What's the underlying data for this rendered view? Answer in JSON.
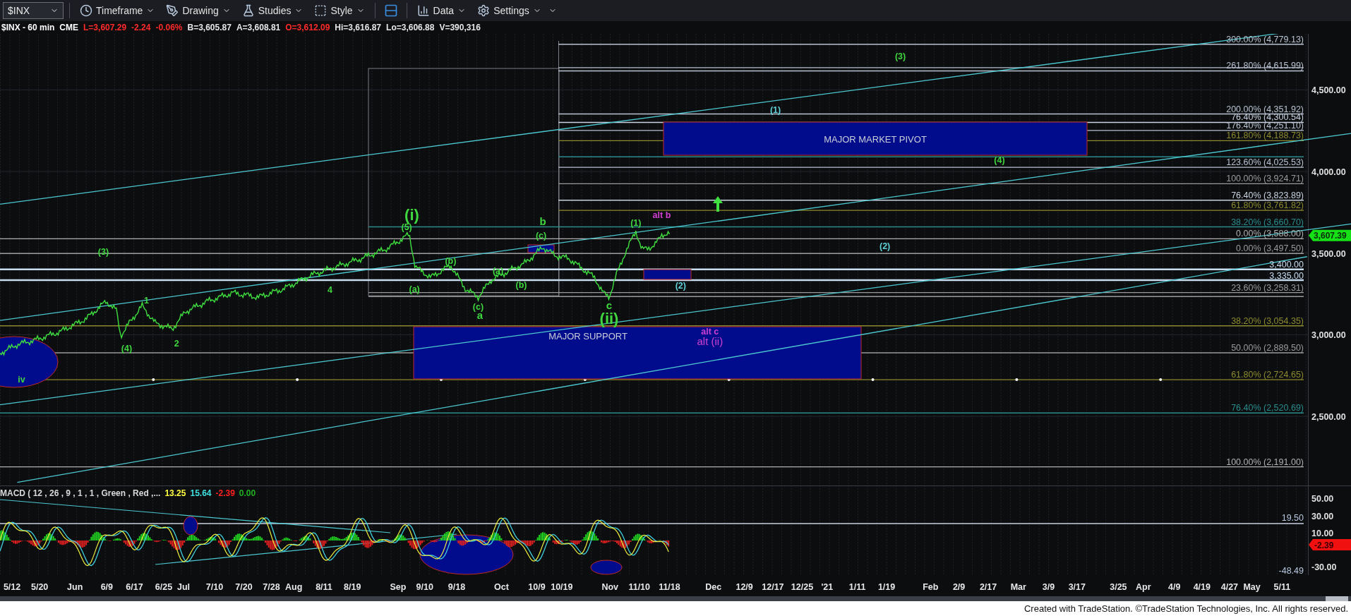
{
  "toolbar": {
    "symbol": "$INX",
    "menus": [
      {
        "label": "Timeframe"
      },
      {
        "label": "Drawing"
      },
      {
        "label": "Studies"
      },
      {
        "label": "Style"
      },
      {
        "label": "Data"
      },
      {
        "label": "Settings"
      }
    ]
  },
  "quote": [
    {
      "text": "$INX - 60 min",
      "color": "#ffffff"
    },
    {
      "text": "CME",
      "color": "#ffffff"
    },
    {
      "text": "L=3,607.29",
      "color": "#ff2a2a"
    },
    {
      "text": "-2.24",
      "color": "#ff2a2a"
    },
    {
      "text": "-0.06%",
      "color": "#ff2a2a"
    },
    {
      "text": "B=3,605.87",
      "color": "#e6e6e6"
    },
    {
      "text": "A=3,608.81",
      "color": "#e6e6e6"
    },
    {
      "text": "O=3,612.09",
      "color": "#ff2a2a"
    },
    {
      "text": "Hi=3,616.87",
      "color": "#e6e6e6"
    },
    {
      "text": "Lo=3,606.88",
      "color": "#e6e6e6"
    },
    {
      "text": "V=390,316",
      "color": "#e6e6e6"
    }
  ],
  "fib_levels": [
    {
      "label": "300.00% (4,779.13)",
      "color": "#b8c2d0"
    },
    {
      "label": "261.80% (4,615.99)",
      "color": "#b8c2d0"
    },
    {
      "label": "200.00% (4,351.92)",
      "color": "#b8c2d0"
    },
    {
      "label": "76.40% (4,300.54)",
      "color": "#c8d2e0"
    },
    {
      "label": "176.40% (4,251.10)",
      "color": "#b8c2d0"
    },
    {
      "label": "161.80% (4,188.73)",
      "color": "#8c8a2e"
    },
    {
      "label": "123.60% (4,025.53)",
      "color": "#b8c2d0"
    },
    {
      "label": "100.00% (3,924.71)",
      "color": "#9a9a9a"
    },
    {
      "label": "76.40% (3,823.89)",
      "color": "#c8d2e0"
    },
    {
      "label": "61.80% (3,761.82)",
      "color": "#8c8a2e"
    },
    {
      "label": "38.20% (3,660.70)",
      "color": "#2a8c8c"
    },
    {
      "label": "0.00% (3,588.00)",
      "color": "#b0b0b0"
    },
    {
      "label": "0.00% (3,497.50)",
      "color": "#9a9a9a"
    },
    {
      "label": "3,400.00",
      "color": "#c8dcf0"
    },
    {
      "label": "3,335.00",
      "color": "#c8dcf0"
    },
    {
      "label": "23.60% (3,258.31)",
      "color": "#9a9a9a"
    },
    {
      "label": "38.20% (3,054.35)",
      "color": "#8c8a2e"
    },
    {
      "label": "50.00% (2,889.50)",
      "color": "#9a9a9a"
    },
    {
      "label": "61.80% (2,724.65)",
      "color": "#8c8a2e"
    },
    {
      "label": "76.40% (2,520.69)",
      "color": "#2a8c8c"
    },
    {
      "label": "100.00% (2,191.00)",
      "color": "#b0b0b0"
    }
  ],
  "price_axis": {
    "ticks": [
      "4,500.00",
      "4,000.00",
      "3,500.00",
      "3,000.00",
      "2,500.00"
    ],
    "last_price": "3,607.39"
  },
  "zones": [
    {
      "label": "MAJOR MARKET PIVOT"
    },
    {
      "label": "MAJOR SUPPORT"
    }
  ],
  "wave_labels": [
    {
      "text": "(3)",
      "kind": "minor",
      "color": "#3fd63f"
    },
    {
      "text": "(1)",
      "kind": "minor",
      "color": "#5fd0d8"
    },
    {
      "text": "(4)",
      "kind": "minor",
      "color": "#3fd63f"
    },
    {
      "text": "(2)",
      "kind": "minor",
      "color": "#5fd0d8"
    },
    {
      "text": "(2)",
      "kind": "minor",
      "color": "#5fd0d8"
    },
    {
      "text": "(i)",
      "kind": "major",
      "color": "#3fd63f"
    },
    {
      "text": "(5)",
      "kind": "minor",
      "color": "#3fd63f"
    },
    {
      "text": "b",
      "kind": "letter",
      "color": "#3fd63f"
    },
    {
      "text": "(c)",
      "kind": "minor",
      "color": "#3fd63f"
    },
    {
      "text": "(1)",
      "kind": "minor",
      "color": "#3fd63f"
    },
    {
      "text": "alt b",
      "kind": "minor",
      "color": "#d040d0"
    },
    {
      "text": "(b)",
      "kind": "minor",
      "color": "#3fd63f"
    },
    {
      "text": "(a)",
      "kind": "minor",
      "color": "#3fd63f"
    },
    {
      "text": "(c)",
      "kind": "minor",
      "color": "#3fd63f"
    },
    {
      "text": "a",
      "kind": "letter",
      "color": "#3fd63f"
    },
    {
      "text": "(a)",
      "kind": "minor",
      "color": "#3fd63f"
    },
    {
      "text": "(b)",
      "kind": "minor",
      "color": "#3fd63f"
    },
    {
      "text": "c",
      "kind": "letter",
      "color": "#3fd63f"
    },
    {
      "text": "(ii)",
      "kind": "major",
      "color": "#3fd63f"
    },
    {
      "text": "alt c",
      "kind": "minor",
      "color": "#d040d0"
    },
    {
      "text": "alt (ii)",
      "kind": "big",
      "color": "#d040d0"
    },
    {
      "text": "(3)",
      "kind": "minor",
      "color": "#3fd63f"
    },
    {
      "text": "1",
      "kind": "minor",
      "color": "#3fd63f"
    },
    {
      "text": "(4)",
      "kind": "minor",
      "color": "#3fd63f"
    },
    {
      "text": "2",
      "kind": "minor",
      "color": "#3fd63f"
    },
    {
      "text": "4",
      "kind": "minor",
      "color": "#3fd63f"
    },
    {
      "text": "iv",
      "kind": "minor",
      "color": "#3fd63f"
    }
  ],
  "macd": {
    "title": "MACD ( 12 , 26 , 9 , 1 , 1 , Green , Red ,...",
    "values": [
      {
        "text": "13.25",
        "color": "#ffff40"
      },
      {
        "text": "15.64",
        "color": "#40e0e0"
      },
      {
        "text": "-2.39",
        "color": "#ff2020"
      },
      {
        "text": "0.00",
        "color": "#20b020"
      }
    ],
    "ticks": [
      "50.00",
      "30.00",
      "10.00",
      "-30.00"
    ],
    "levels": [
      "19.50",
      "-48.49"
    ],
    "last_value": "-2.39"
  },
  "date_axis": [
    "5/12",
    "5/20",
    "Jun",
    "6/9",
    "6/17",
    "6/25",
    "Jul",
    "7/10",
    "7/20",
    "7/28",
    "Aug",
    "8/11",
    "8/19",
    "Sep",
    "9/10",
    "9/18",
    "Oct",
    "10/9",
    "10/19",
    "Nov",
    "11/10",
    "11/18",
    "Dec",
    "12/9",
    "12/17",
    "12/25",
    "'21",
    "1/11",
    "1/19",
    "Feb",
    "2/9",
    "2/17",
    "Mar",
    "3/9",
    "3/17",
    "3/25",
    "Apr",
    "4/9",
    "4/19",
    "4/27",
    "May",
    "5/11"
  ],
  "footer": "Created with TradeStation. ©TradeStation Technologies, Inc. All rights reserved."
}
